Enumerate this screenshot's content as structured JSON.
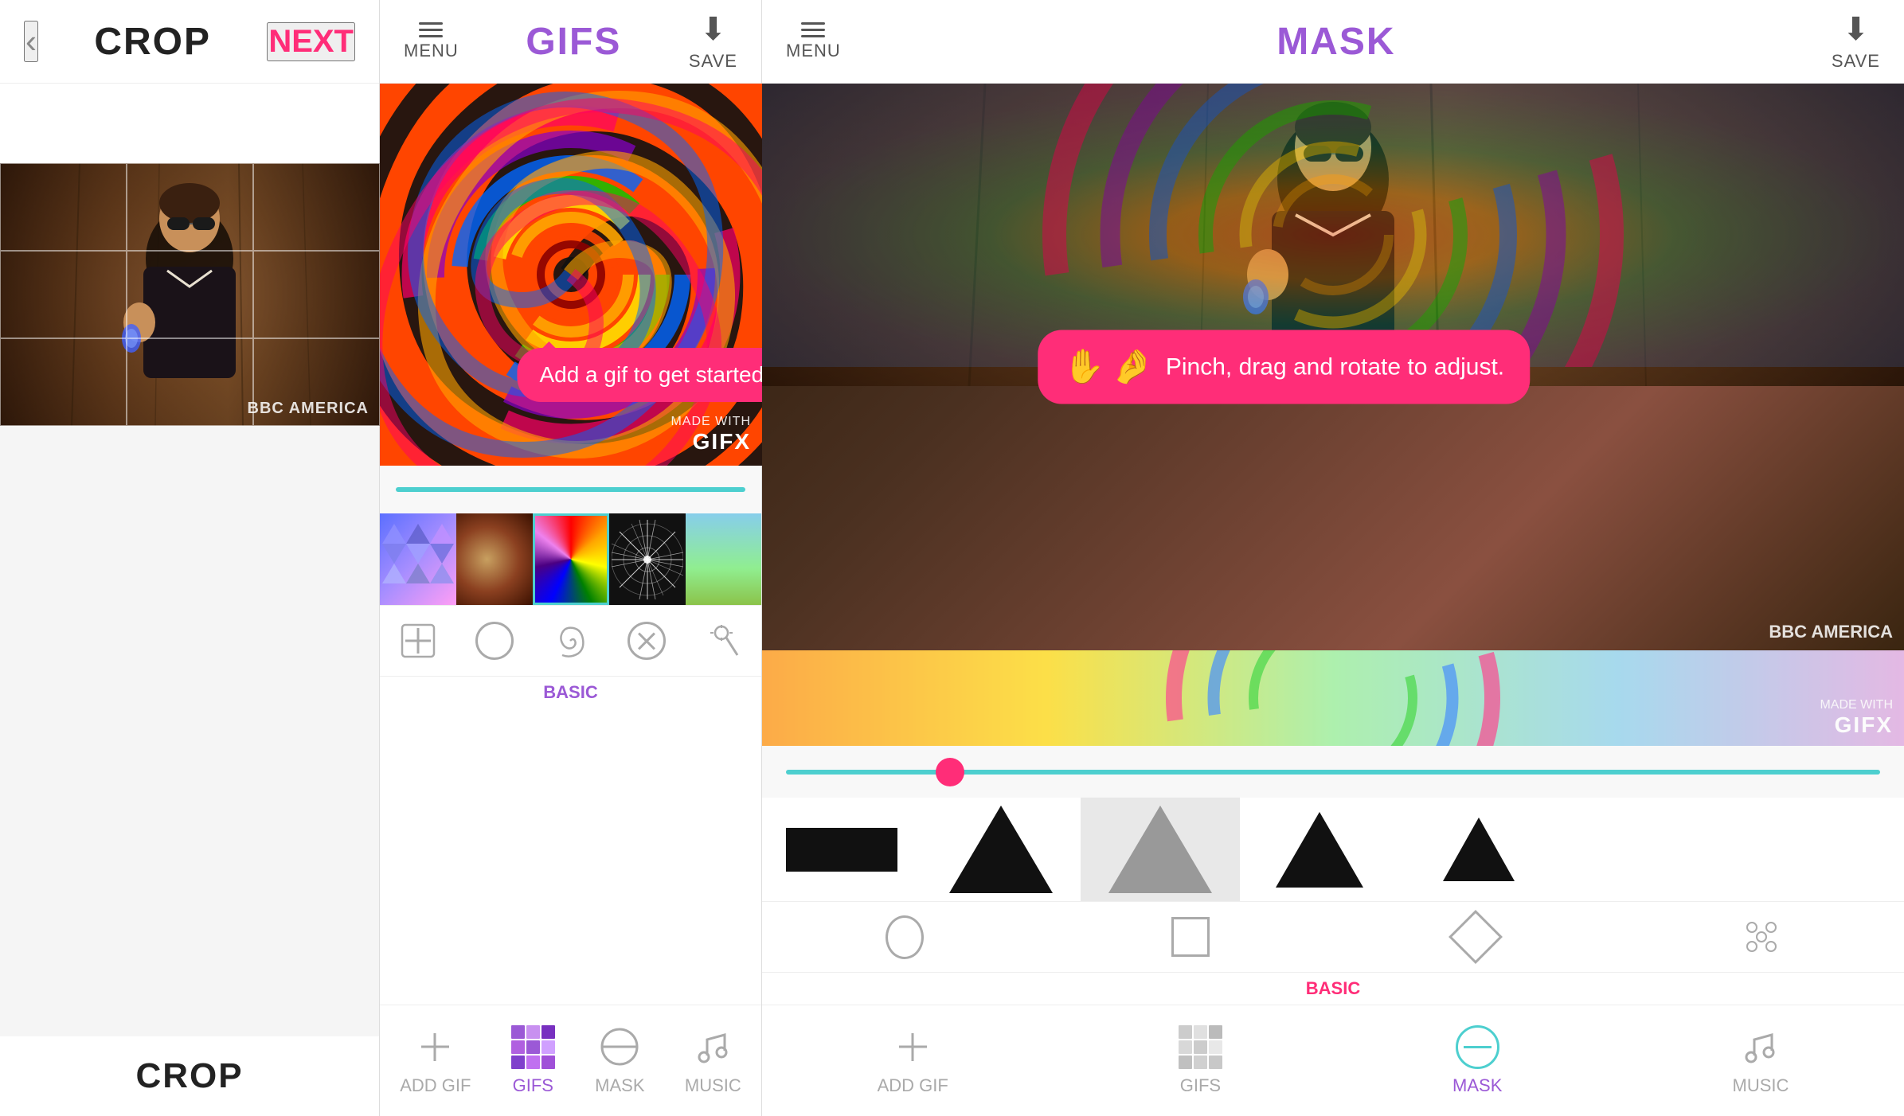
{
  "panels": {
    "crop": {
      "title": "CROP",
      "back_button": "‹",
      "next_button": "NEXT",
      "bbc_watermark": "BBC AMERICA",
      "bottom_label": "CROP"
    },
    "gifs": {
      "title": "GIFS",
      "menu_label": "MENU",
      "save_label": "SAVE",
      "tooltip": "Add a gif to get started",
      "gifx_made_with": "MADE WITH",
      "gifx_brand": "GIFX",
      "toolbar": {
        "active_tab": "BASIC",
        "tab_label": "BASIC"
      },
      "bottom_nav": {
        "add_gif": "ADD GIF",
        "gifs": "GIFS",
        "mask": "MASK",
        "music": "MUSIC"
      }
    },
    "mask": {
      "title": "MASK",
      "menu_label": "MENU",
      "save_label": "SAVE",
      "tooltip": "Pinch, drag and rotate to adjust.",
      "gifx_made_with": "MADE WITH",
      "gifx_brand": "GIFX",
      "bbc_watermark": "BBC AMERICA",
      "toolbar": {
        "active_tab": "BASIC",
        "tab_label": "BASIC"
      },
      "bottom_nav": {
        "add_gif": "ADD GIF",
        "gifs": "GIFS",
        "mask": "MASK",
        "music": "MUSIC"
      }
    }
  }
}
